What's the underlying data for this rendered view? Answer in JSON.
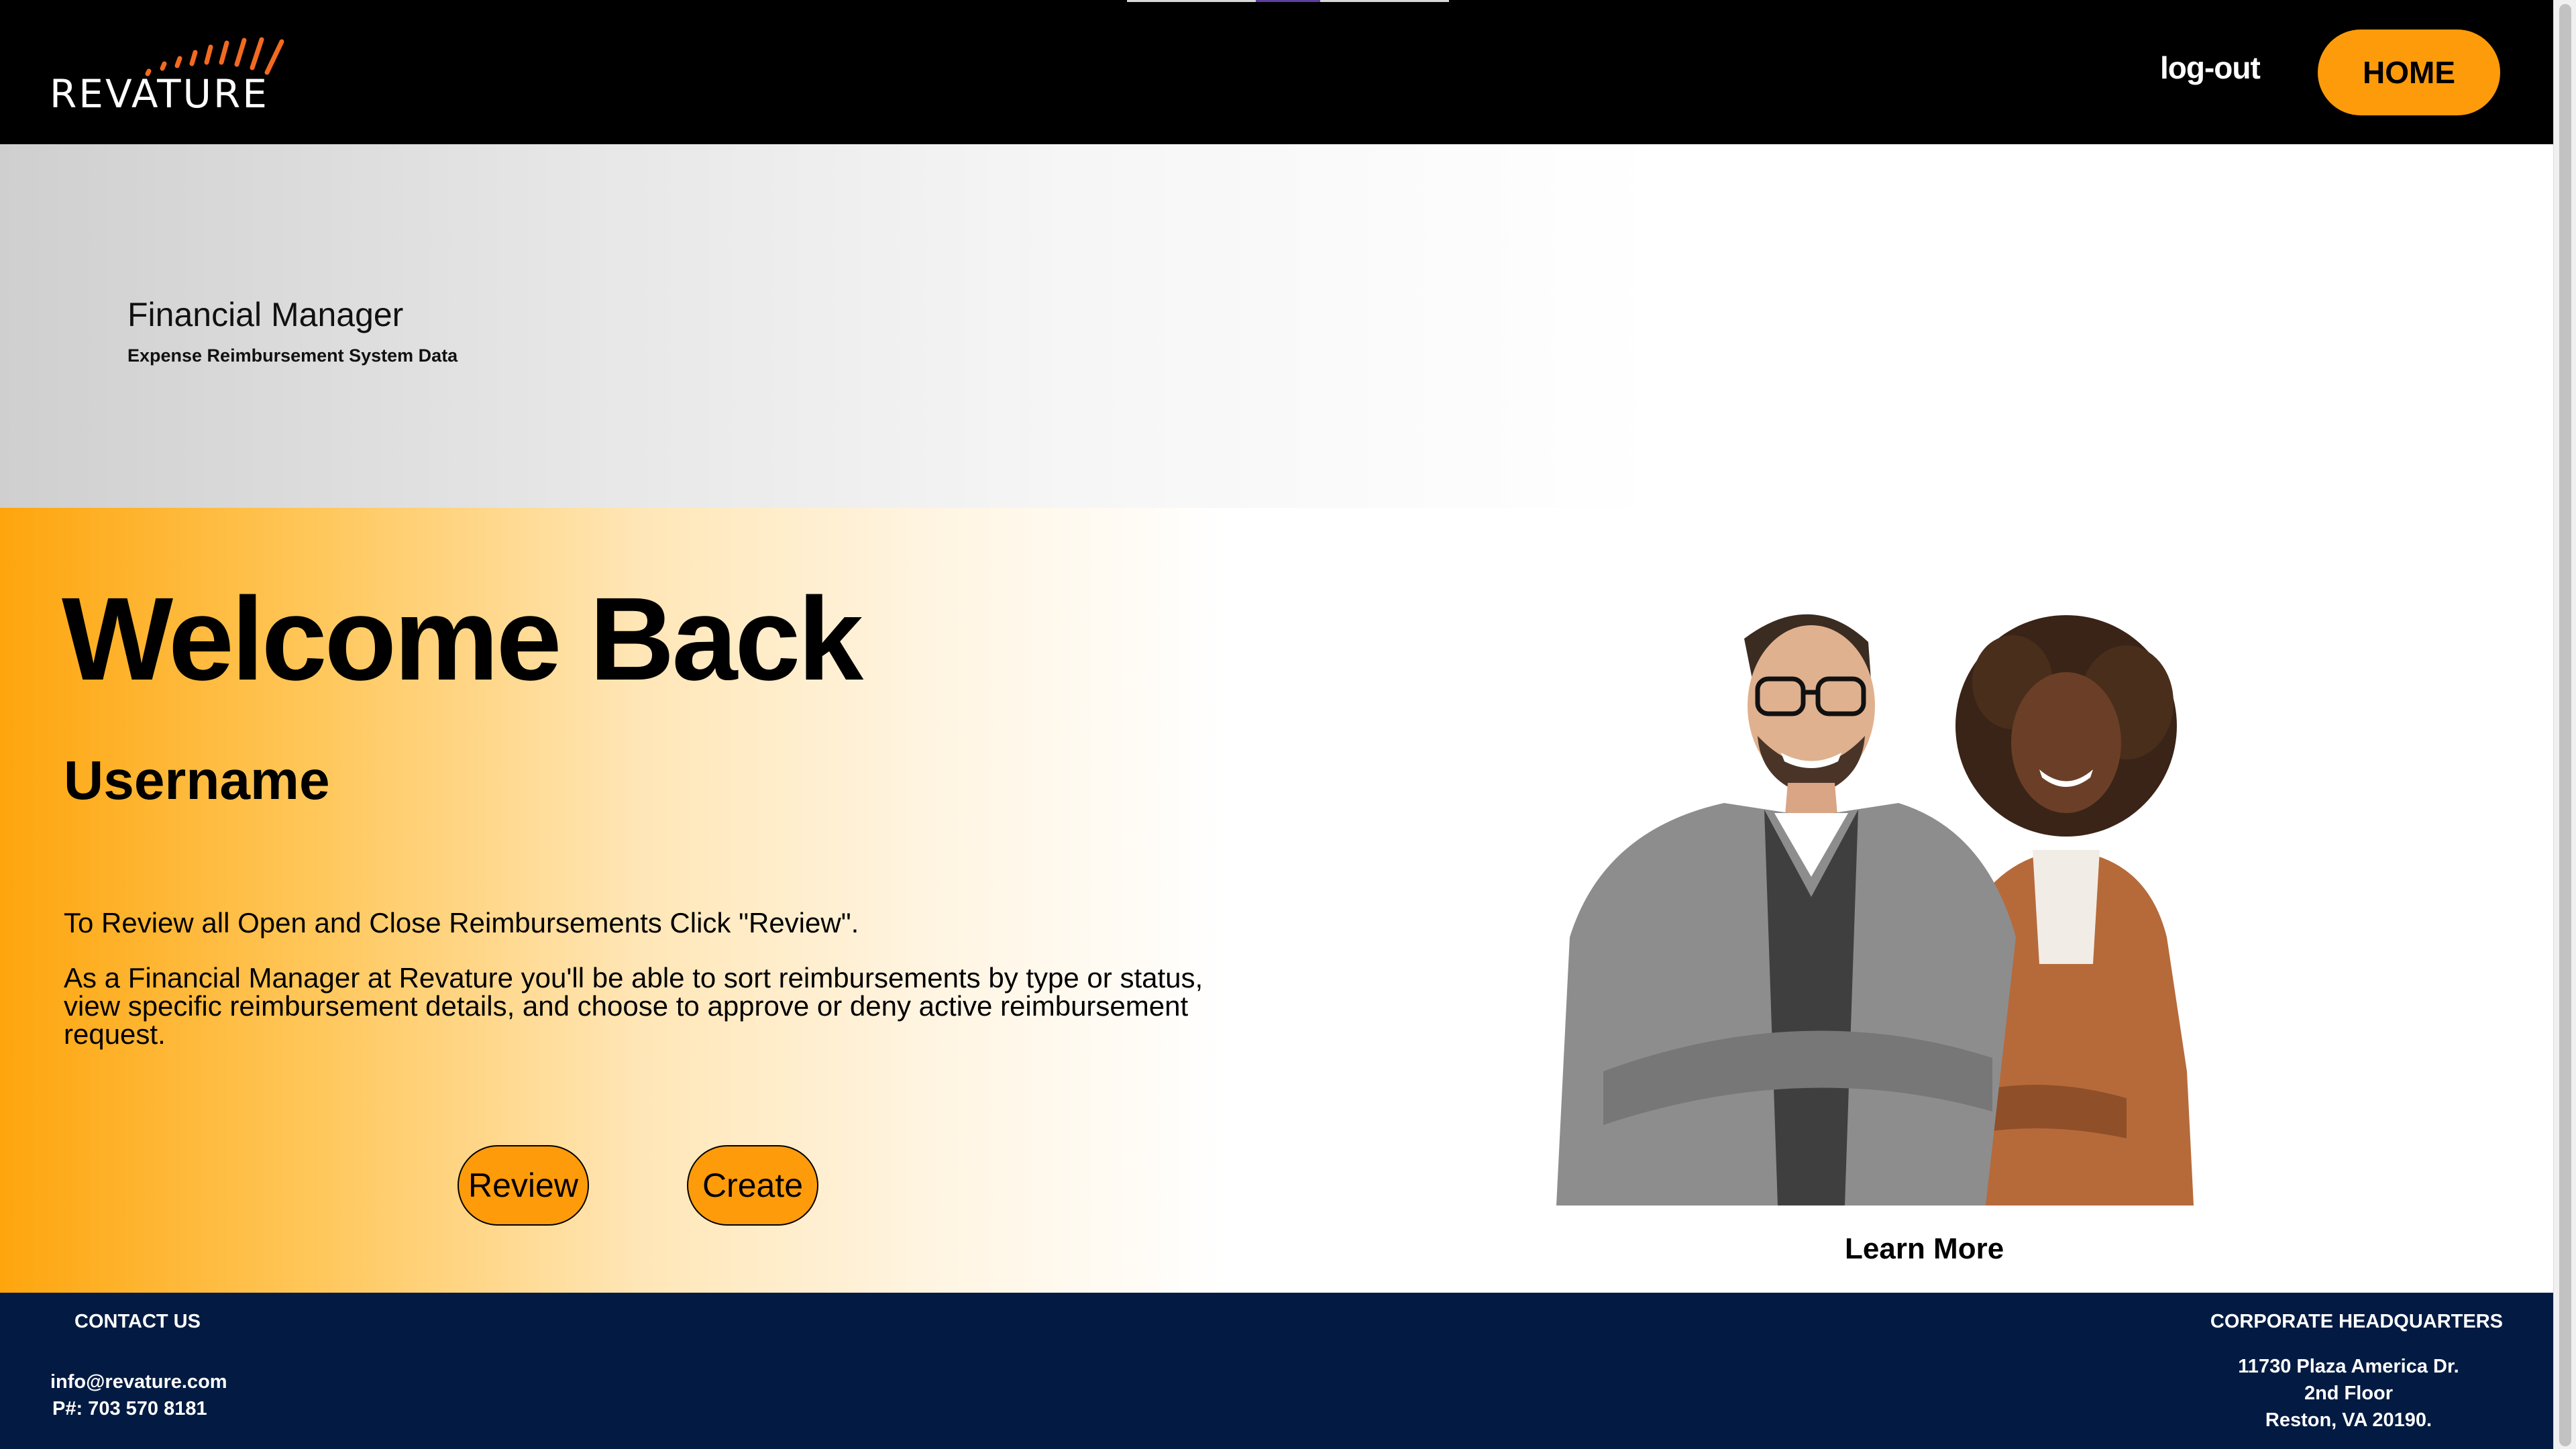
{
  "nav": {
    "logo_text": "REVATURE",
    "logout_label": "log-out",
    "home_label": "HOME"
  },
  "header": {
    "title": "Financial Manager",
    "subtitle": "Expense Reimbursement System Data"
  },
  "welcome": {
    "heading": "Welcome Back",
    "username": "Username",
    "instruction": "To Review all Open and Close Reimbursements Click \"Review\".",
    "description": "As a Financial Manager at Revature you'll be able to sort reimbursements by type or status, view specific reimbursement details, and choose to approve or deny active reimbursement request.",
    "review_label": "Review",
    "create_label": "Create",
    "learn_more_label": "Learn More"
  },
  "footer": {
    "contact_heading": "CONTACT US",
    "email": "info@revature.com",
    "phone": "P#: 703 570 8181",
    "hq_heading": "CORPORATE HEADQUARTERS",
    "address_line1": "11730 Plaza America Dr.",
    "address_line2": "2nd Floor",
    "address_line3": "Reston, VA 20190."
  },
  "colors": {
    "accent": "#fe9b0a",
    "nav_bg": "#000000",
    "footer_bg": "#031b42"
  }
}
